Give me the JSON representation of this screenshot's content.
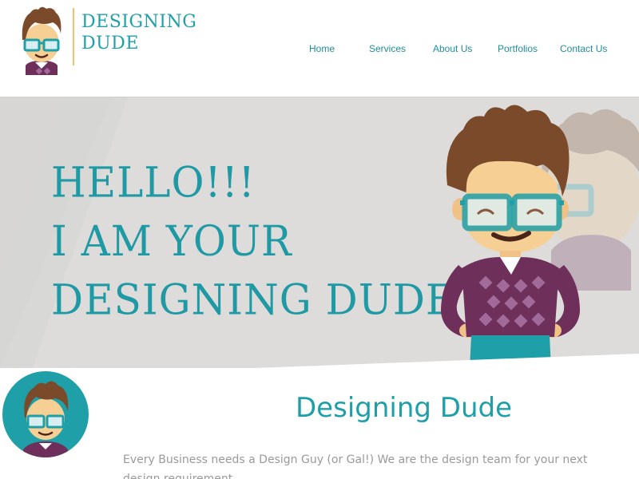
{
  "brand": {
    "line1": "DESIGNING",
    "line2": "DUDE",
    "accent_color": "#1fa0a8",
    "divider_color": "#f2c26b"
  },
  "nav": {
    "items": [
      {
        "label": "Home"
      },
      {
        "label": "Services"
      },
      {
        "label": "About Us"
      },
      {
        "label": "Portfolios"
      },
      {
        "label": "Contact Us"
      }
    ]
  },
  "hero": {
    "lines": [
      "HELLO!!!",
      "I AM YOUR",
      "DESIGNING DUDE"
    ],
    "background": "#dddcda"
  },
  "intro": {
    "heading": "Designing Dude",
    "text": "Every Business needs a Design Guy (or Gal!) We are the design team for your next design requirement"
  },
  "character_colors": {
    "hair": "#7a4a2a",
    "skin": "#f6cf95",
    "glasses": "#1fa0a8",
    "sweater": "#6e2f5a",
    "diamond": "#a26a98",
    "pants": "#1fa0a8"
  }
}
